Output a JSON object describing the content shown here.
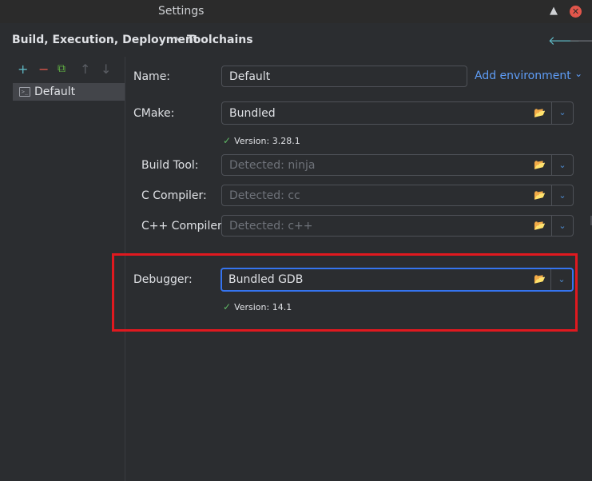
{
  "window": {
    "title": "Settings",
    "minimize_glyph": "▲",
    "close_glyph": "✕"
  },
  "breadcrumb": {
    "parent": "Build, Execution, Deployment",
    "separator": "›",
    "current": "Toolchains"
  },
  "nav": {
    "back_glyph": "🡐",
    "forward_glyph": "🡒"
  },
  "left_toolbar": {
    "add": "+",
    "remove": "−",
    "copy": "⧉",
    "up": "↑",
    "down": "↓"
  },
  "toolchains": [
    {
      "label": "Default",
      "icon": ">_"
    }
  ],
  "form": {
    "name_label": "Name:",
    "name_value": "Default",
    "add_environment": "Add environment",
    "add_environment_chevron": "⌄",
    "cmake_label": "CMake:",
    "cmake_value": "Bundled",
    "cmake_version": "Version: 3.28.1",
    "build_tool_label": "Build Tool:",
    "build_tool_placeholder": "Detected: ninja",
    "c_compiler_label": "C Compiler:",
    "c_compiler_placeholder": "Detected: cc",
    "cpp_compiler_label": "C++ Compiler:",
    "cpp_compiler_placeholder": "Detected: c++",
    "debugger_label": "Debugger:",
    "debugger_value": "Bundled GDB",
    "debugger_version": "Version: 14.1",
    "check_glyph": "✓",
    "folder_glyph": "📂",
    "dropdown_glyph": "⌄"
  },
  "colors": {
    "accent": "#3574f0",
    "link": "#5e9cf5",
    "highlight": "#e0191f",
    "ok": "#5fb865"
  }
}
